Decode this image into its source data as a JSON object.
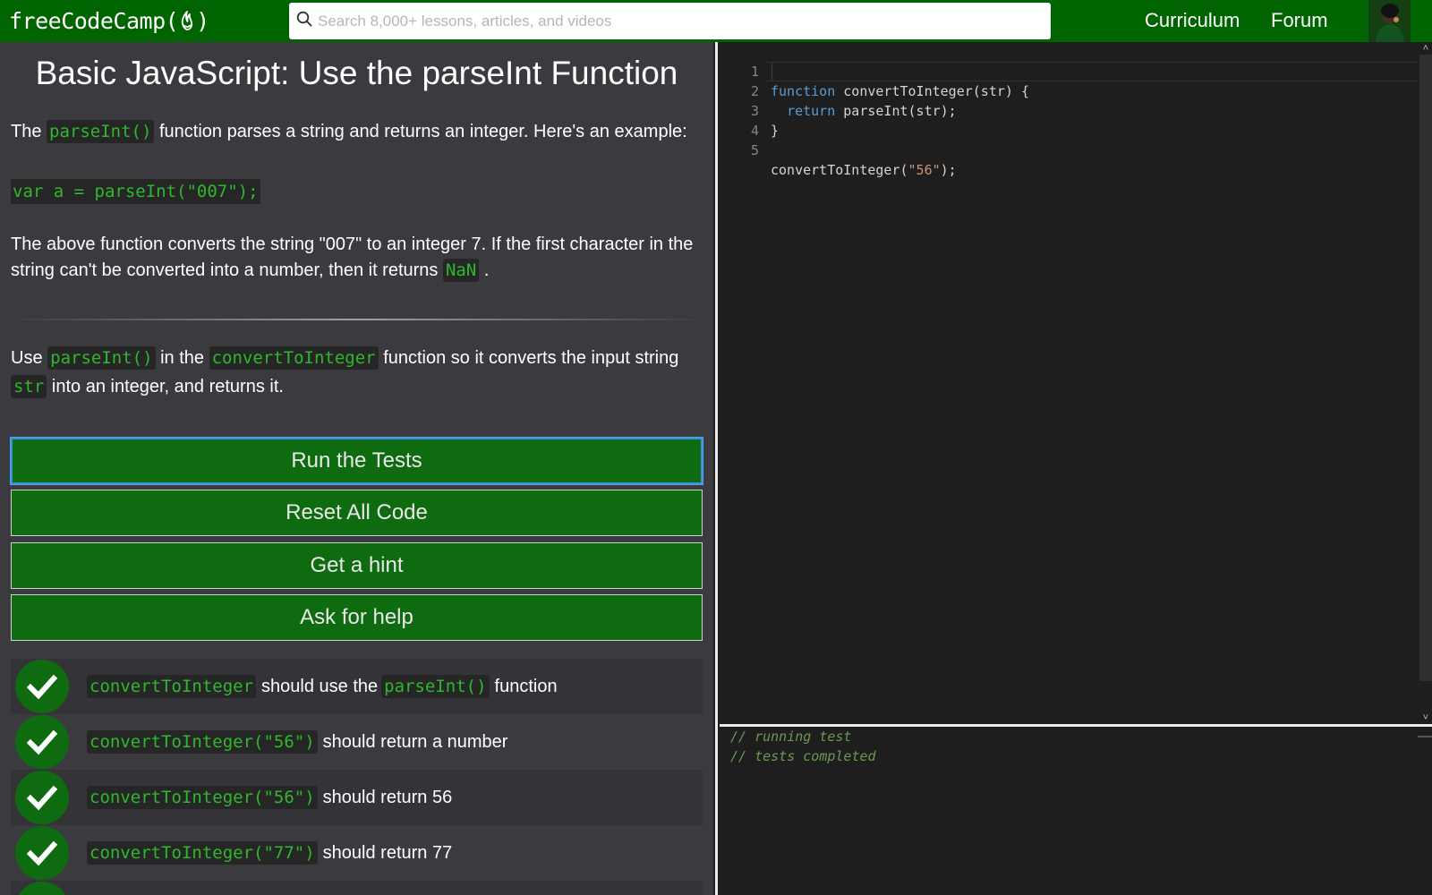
{
  "nav": {
    "logo_prefix": "freeCodeCamp(",
    "logo_suffix": ")",
    "search_placeholder": "Search 8,000+ lessons, articles, and videos",
    "links": [
      "Curriculum",
      "Forum"
    ],
    "brand_color": "#006400"
  },
  "challenge": {
    "title": "Basic JavaScript: Use the parseInt Function",
    "intro_prefix": "The",
    "intro_code": "parseInt()",
    "intro_suffix": "function parses a string and returns an integer. Here's an example:",
    "example_code": "var a = parseInt(\"007\");",
    "explain_text": "The above function converts the string \"007\" to an integer 7. If the first character in the string can't be converted into a number, then it returns",
    "explain_code": "NaN",
    "explain_end": ".",
    "task_use": "Use",
    "task_code1": "parseInt()",
    "task_in_the": "in the",
    "task_code2": "convertToInteger",
    "task_mid": "function so it converts the input string",
    "task_code3": "str",
    "task_end": "into an integer, and returns it."
  },
  "buttons": {
    "run": "Run the Tests",
    "reset": "Reset All Code",
    "hint": "Get a hint",
    "help": "Ask for help"
  },
  "tests": [
    {
      "code": "convertToInteger",
      "text": "should use the",
      "code2": "parseInt()",
      "text2": "function",
      "passed": true
    },
    {
      "code": "convertToInteger(\"56\")",
      "text": "should return a number",
      "passed": true
    },
    {
      "code": "convertToInteger(\"56\")",
      "text": "should return 56",
      "passed": true
    },
    {
      "code": "convertToInteger(\"77\")",
      "text": "should return 77",
      "passed": true
    }
  ],
  "editor": {
    "line_numbers": [
      "1",
      "2",
      "3",
      "4",
      "5"
    ],
    "lines": [
      {
        "kw": "function",
        "rest": " convertToInteger(str) {"
      },
      {
        "indent": "  ",
        "kw": "return",
        "rest": " parseInt(str);"
      },
      {
        "rest": "}"
      },
      {
        "rest": ""
      },
      {
        "pre": "convertToInteger(",
        "str": "\"56\"",
        "post": ");"
      }
    ]
  },
  "console": {
    "lines": [
      "// running test",
      "// tests completed"
    ]
  }
}
